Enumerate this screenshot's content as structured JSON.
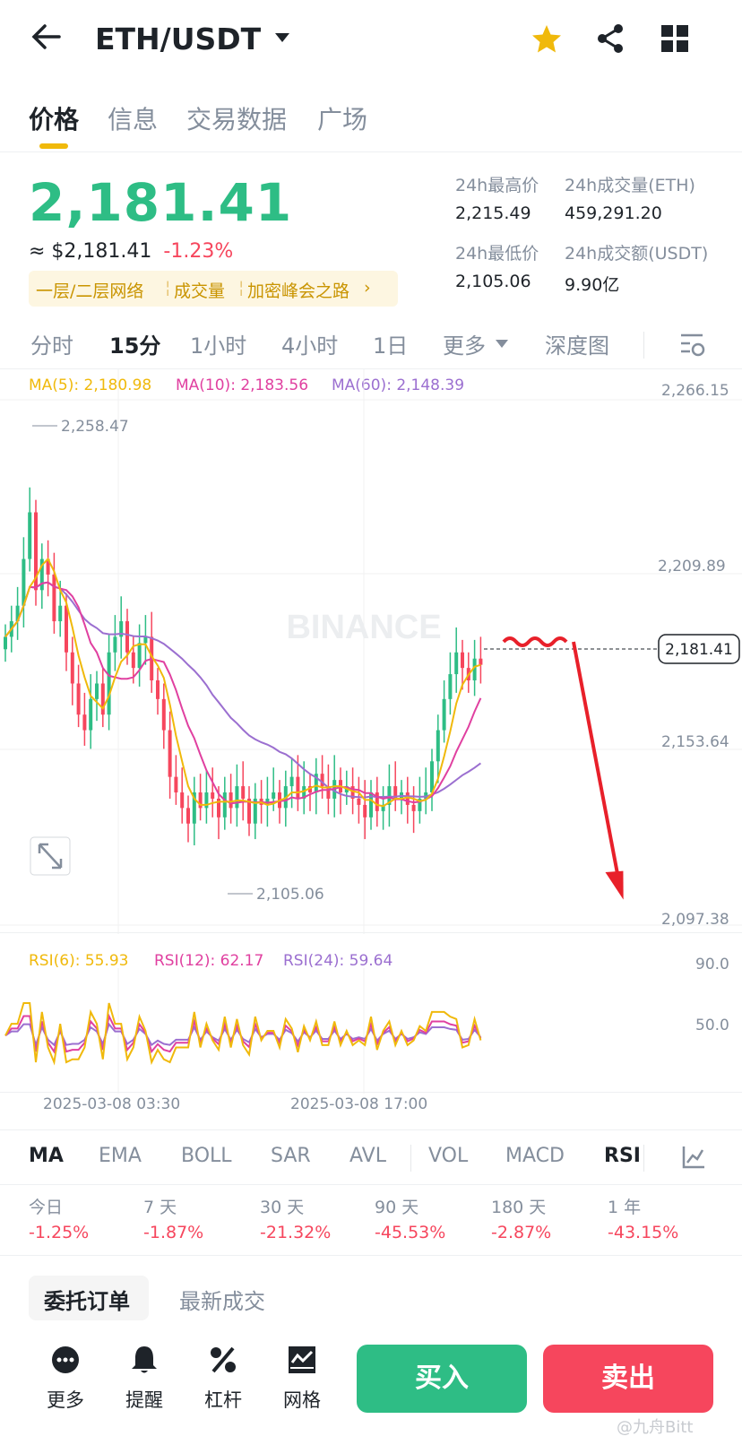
{
  "header": {
    "pair": "ETH/USDT"
  },
  "tabs": [
    {
      "label": "价格"
    },
    {
      "label": "信息"
    },
    {
      "label": "交易数据"
    },
    {
      "label": "广场"
    }
  ],
  "price": {
    "last": "2,181.41",
    "approx": "≈ $2,181.41",
    "change": "-1.23%",
    "tags": [
      "一层/二层网络",
      "成交量",
      "加密峰会之路"
    ]
  },
  "stats": {
    "high_label": "24h最高价",
    "high": "2,215.49",
    "vol_eth_label": "24h成交量(ETH)",
    "vol_eth": "459,291.20",
    "low_label": "24h最低价",
    "low": "2,105.06",
    "vol_usdt_label": "24h成交额(USDT)",
    "vol_usdt": "9.90亿"
  },
  "intervals": [
    {
      "label": "分时"
    },
    {
      "label": "15分"
    },
    {
      "label": "1小时"
    },
    {
      "label": "4小时"
    },
    {
      "label": "1日"
    },
    {
      "label": "更多"
    },
    {
      "label": "深度图"
    }
  ],
  "ma": {
    "ma5": "MA(5): 2,180.98",
    "ma10": "MA(10): 2,183.56",
    "ma60": "MA(60): 2,148.39"
  },
  "price_axis": [
    "2,266.15",
    "2,209.89",
    "2,153.64",
    "2,097.38"
  ],
  "chart_marks": {
    "high": "2,258.47",
    "low": "2,105.06",
    "current": "2,181.41",
    "watermark": "BINANCE"
  },
  "rsi": {
    "rsi6": "RSI(6): 55.93",
    "rsi12": "RSI(12): 62.17",
    "rsi24": "RSI(24): 59.64",
    "axis": [
      "90.0",
      "50.0"
    ]
  },
  "time_axis": [
    "2025-03-08 03:30",
    "2025-03-08 17:00"
  ],
  "indicators": [
    "MA",
    "EMA",
    "BOLL",
    "SAR",
    "AVL",
    "VOL",
    "MACD",
    "RSI"
  ],
  "performance": [
    {
      "label": "今日",
      "value": "-1.25%"
    },
    {
      "label": "7 天",
      "value": "-1.87%"
    },
    {
      "label": "30 天",
      "value": "-21.32%"
    },
    {
      "label": "90 天",
      "value": "-45.53%"
    },
    {
      "label": "180 天",
      "value": "-2.87%"
    },
    {
      "label": "1 年",
      "value": "-43.15%"
    }
  ],
  "order_tabs": [
    "委托订单",
    "最新成交"
  ],
  "bottom": {
    "more": "更多",
    "alert": "提醒",
    "leverage": "杠杆",
    "grid": "网格",
    "buy": "买入",
    "sell": "卖出"
  },
  "watermark_credit": "@九舟Bitt",
  "colors": {
    "up": "#2ebd85",
    "down": "#f6465d",
    "accent": "#f0b90b",
    "ma10": "#e040a0",
    "ma60": "#9b6fd0"
  },
  "chart_data": {
    "type": "candlestick",
    "ylim": [
      2097.38,
      2266.15
    ],
    "series": [
      {
        "name": "MA(5)",
        "value": 2180.98
      },
      {
        "name": "MA(10)",
        "value": 2183.56
      },
      {
        "name": "MA(60)",
        "value": 2148.39
      }
    ],
    "marked_high": 2258.47,
    "marked_low": 2105.06,
    "last_price": 2181.41,
    "rsi_ylim": [
      10,
      100
    ],
    "rsi_values": {
      "RSI(6)": 55.93,
      "RSI(12)": 62.17,
      "RSI(24)": 59.64
    }
  }
}
